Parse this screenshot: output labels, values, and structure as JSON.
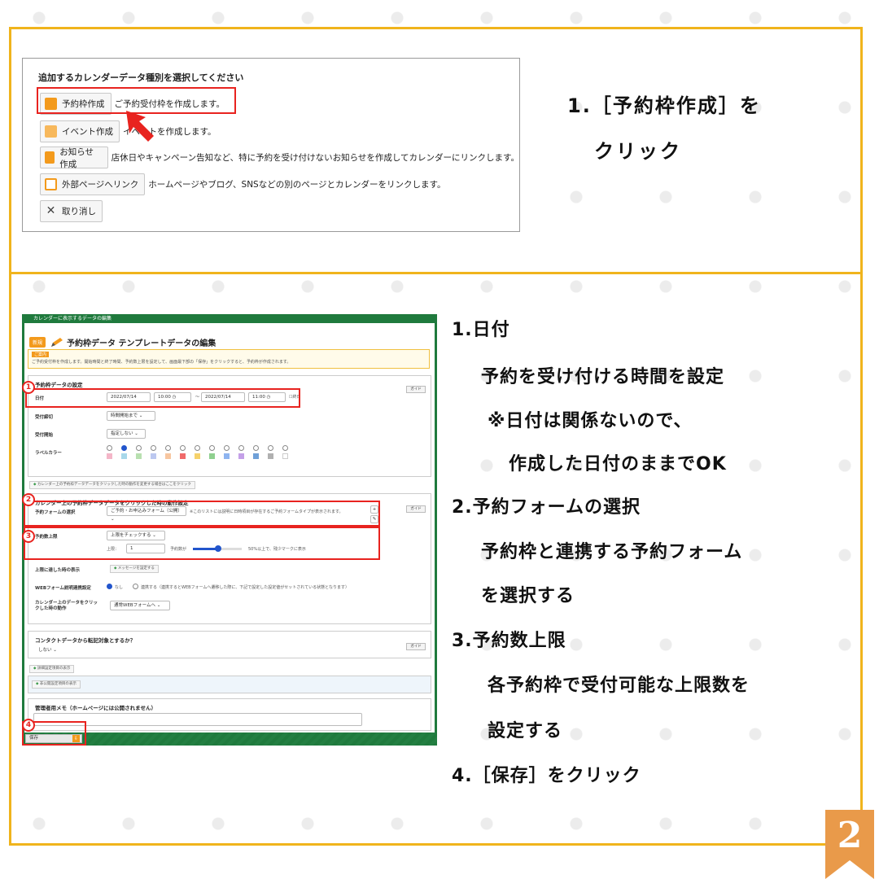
{
  "colors": {
    "frame": "#f0b41c",
    "highlight": "#e8231f",
    "app_green": "#1f7a3d",
    "badge": "#e99a4a"
  },
  "top_screenshot": {
    "heading": "追加するカレンダーデータ種別を選択してください",
    "rows": [
      {
        "button": "予約枠作成",
        "icon": "reserve-icon",
        "icon_color": "#f39a1c",
        "desc": "ご予約受付枠を作成します。"
      },
      {
        "button": "イベント作成",
        "icon": "event-icon",
        "icon_color": "#f39a1c",
        "desc": "イベントを作成します。"
      },
      {
        "button": "お知らせ作成",
        "icon": "megaphone-icon",
        "icon_color": "#f39a1c",
        "desc": "店休日やキャンペーン告知など、特に予約を受け付けないお知らせを作成してカレンダーにリンクします。"
      },
      {
        "button": "外部ページへリンク",
        "icon": "external-link-icon",
        "icon_color": "#f39a1c",
        "desc": "ホームページやブログ、SNSなどの別のページとカレンダーをリンクします。"
      },
      {
        "button": "取り消し",
        "icon": "close-icon",
        "icon_color": "#555555",
        "desc": ""
      }
    ]
  },
  "step1_text": {
    "line1": "1.［予約枠作成］を",
    "line2": "クリック"
  },
  "form_screenshot": {
    "window_title": "カレンダーに表示するデータの編集",
    "badge": "新規",
    "title": "予約枠データ テンプレートデータの編集",
    "note_tag": "ご案内",
    "note": "ご予約受付枠を作成します。開始時間と終了時間、予約数上限を設定して、画面最下部の「保存」をクリックすると、予約枠が作成されます。",
    "section1_title": "予約枠データの設定",
    "date_label": "日付",
    "date_start": "2022/07/14",
    "time_start": "10:00",
    "tilde": "〜",
    "date_end": "2022/07/14",
    "time_end": "11:00",
    "allday": "終日",
    "deadline_label": "受付締切",
    "deadline_value": "時間開始まで",
    "start_label": "受付開始",
    "start_value": "指定しない",
    "color_label": "ラベルカラー",
    "guide": "ガイド",
    "copy_link": "カレンダー上の予約枠データデータをクリックした時の動作を変更する場合はここをクリック",
    "section2_title": "カレンダー上の予約枠データデータをクリックした時の動作設定",
    "form_label": "予約フォームの選択",
    "form_value": "ご予約・お申込みフォーム（公開）",
    "form_note": "※このリストには説明に日時項目が存在するご予約フォームタイプが表示されます。",
    "limit_label": "予約数上限",
    "limit_select": "上限をチェックする",
    "limit_prefix": "上限：",
    "limit_value": "1",
    "limit_bar_label": "予約数が",
    "limit_bar_note": "50%以上で、残少マークに表示",
    "reached_label": "上限に達した時の表示",
    "reached_link": "メッセージを設定する",
    "web_label": "WEBフォーム説明連携設定",
    "web_opt1": "なし",
    "web_opt2": "連携する（連携するとWEBフォームへ遷移した際に、下記で設定した設定値がセットされている状態となります）",
    "click_label": "カレンダー上のデータをクリックした時の動作",
    "click_value": "通常WEBフォームへ",
    "contact_title": "コンタクトデータから転記対象とするか？",
    "contact_value": "しない",
    "detail_link": "詳細設定項目の表示",
    "hidden_link": "非公開設定項目の表示",
    "memo_title": "管理者用メモ（ホームページには公開されません）",
    "save": "保存"
  },
  "markers": [
    "1",
    "2",
    "3",
    "4"
  ],
  "instructions": [
    {
      "text": "1.日付",
      "bold": true
    },
    {
      "text": "予約を受け付ける時間を設定",
      "bold": true
    },
    {
      "text": "※日付は関係ないので、",
      "bold": true
    },
    {
      "text": "作成した日付のままでOK",
      "bold": true
    },
    {
      "text": "2.予約フォームの選択",
      "bold": true
    },
    {
      "text": "予約枠と連携する予約フォーム",
      "bold": true
    },
    {
      "text": "を選択する",
      "bold": true
    },
    {
      "text": "3.予約数上限",
      "bold": true
    },
    {
      "text": "各予約枠で受付可能な上限数を",
      "bold": true
    },
    {
      "text": "設定する",
      "bold": true
    },
    {
      "text": "4.［保存］をクリック",
      "bold": true
    }
  ],
  "page_number": "2"
}
